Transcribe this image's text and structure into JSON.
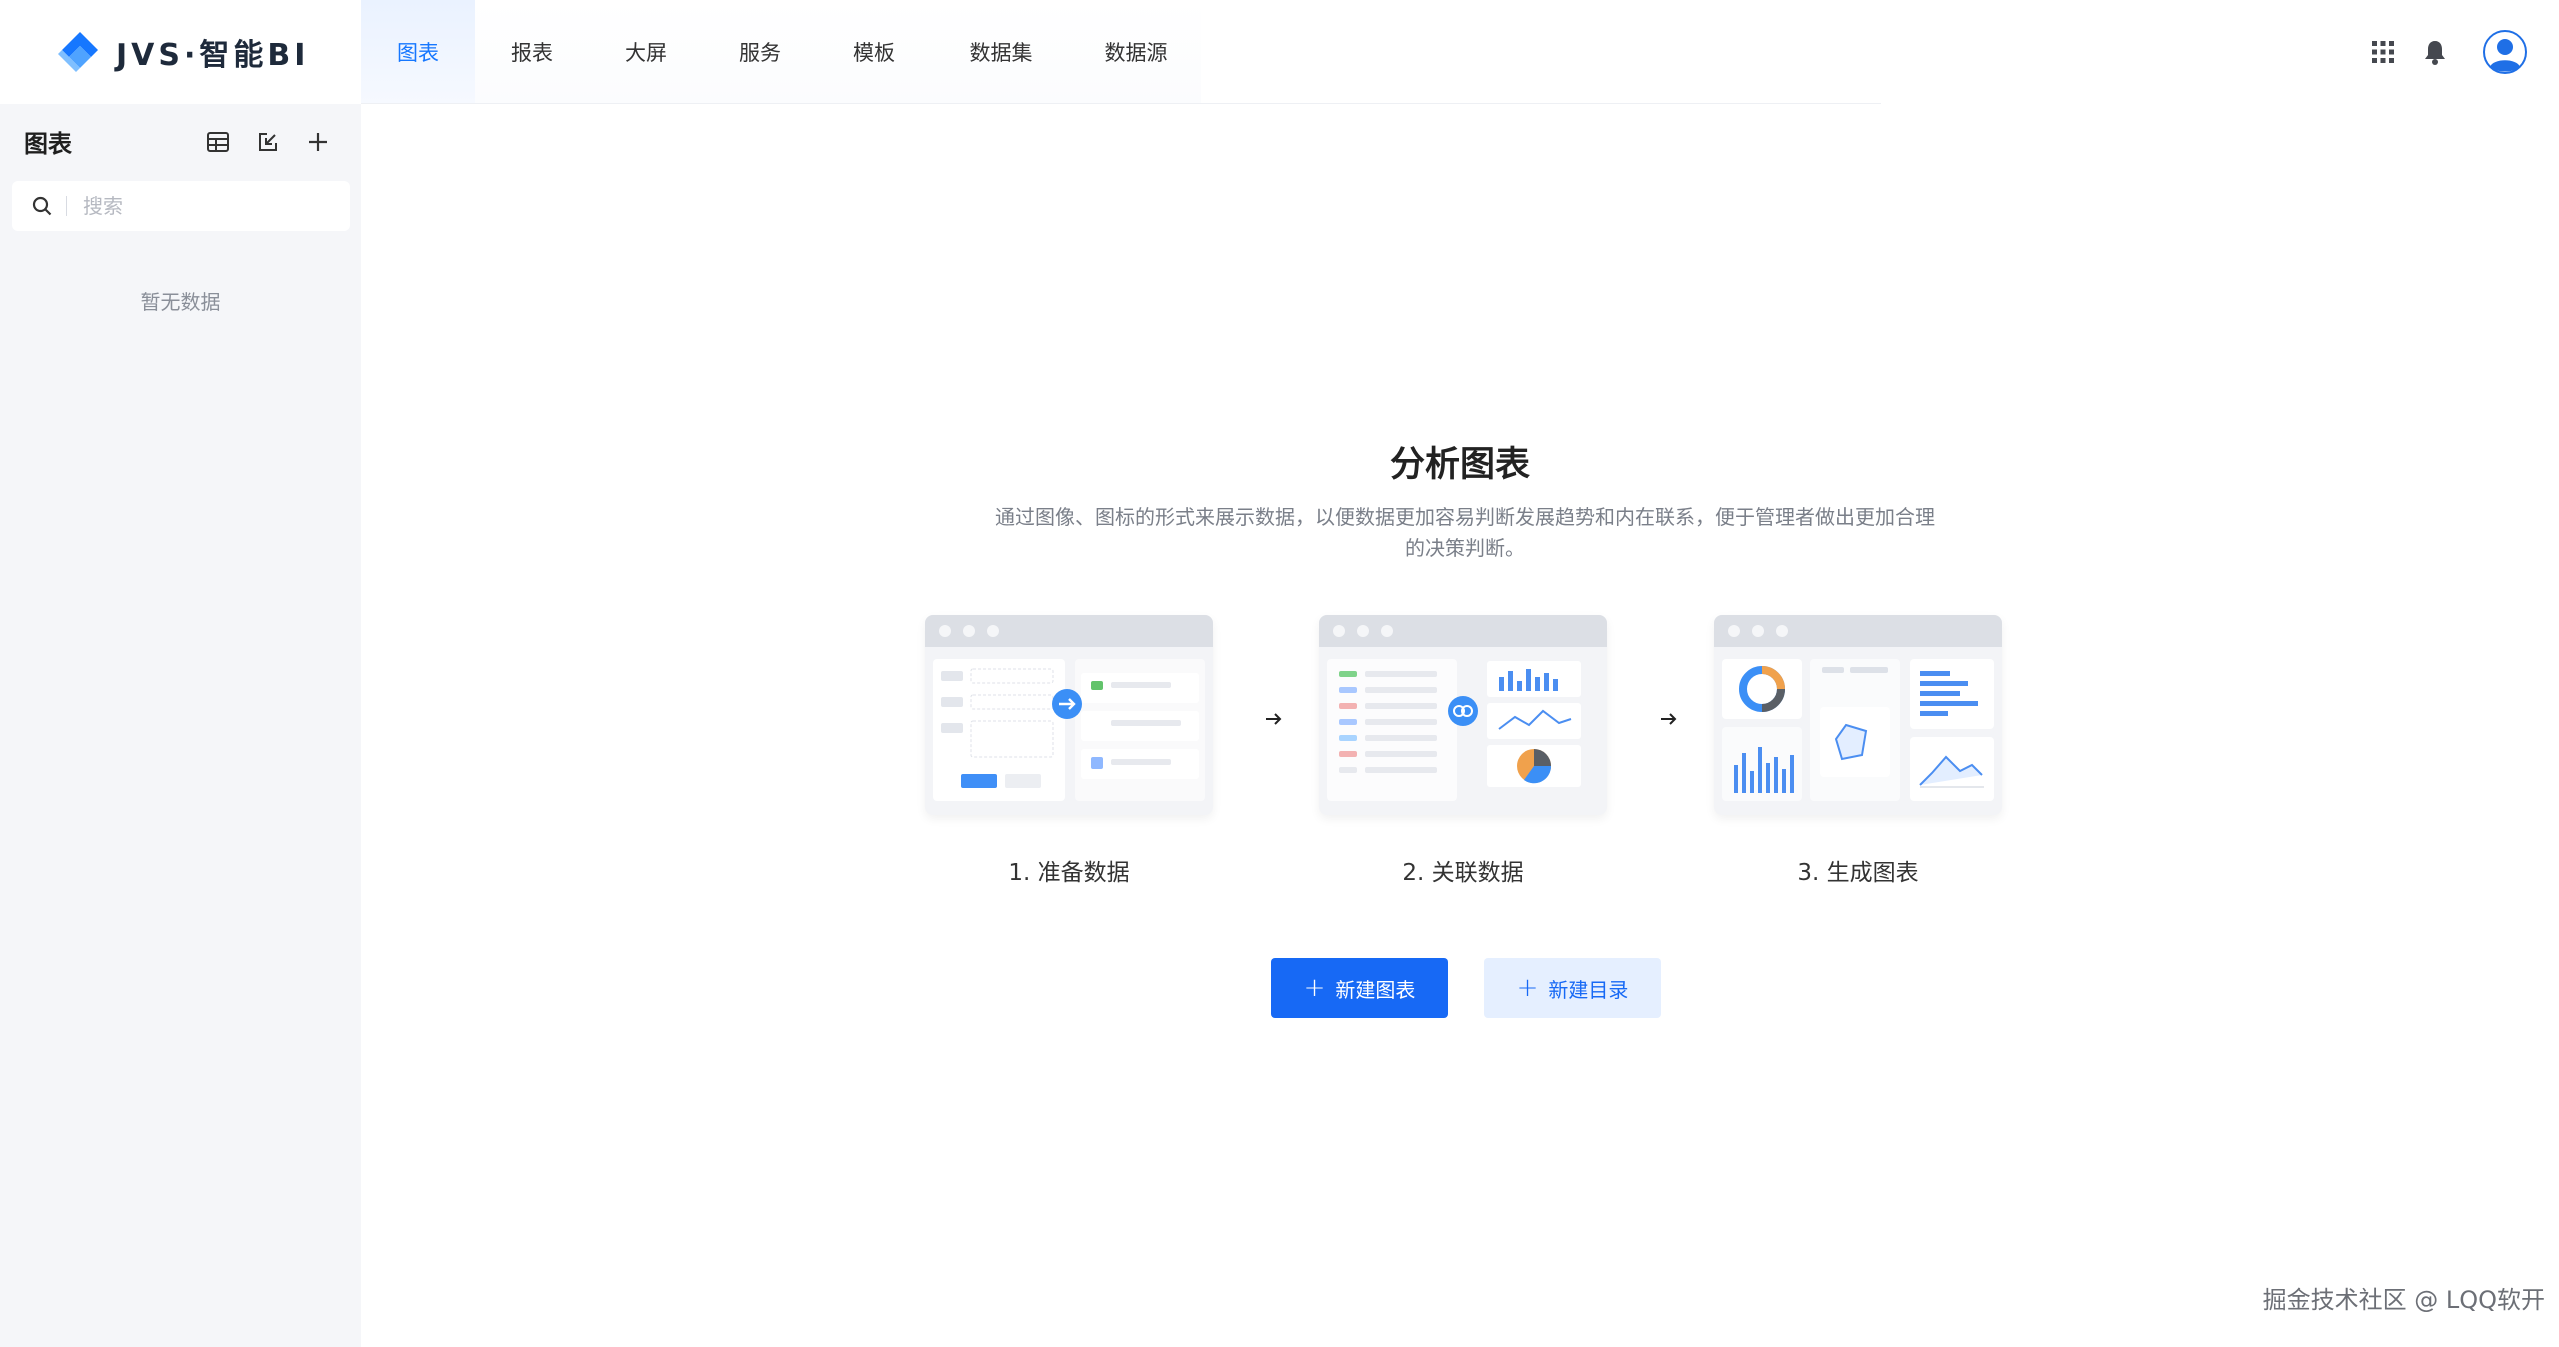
{
  "app": {
    "logo_text": "JVS·智能BI"
  },
  "nav": {
    "items": [
      {
        "label": "图表",
        "active": true
      },
      {
        "label": "报表"
      },
      {
        "label": "大屏"
      },
      {
        "label": "服务"
      },
      {
        "label": "模板"
      },
      {
        "label": "数据集"
      },
      {
        "label": "数据源"
      }
    ]
  },
  "top_icons": [
    "apps-grid-icon",
    "bell-icon",
    "user-avatar-icon"
  ],
  "sidebar": {
    "title": "图表",
    "tools": [
      "table-icon",
      "import-icon",
      "plus-icon"
    ],
    "search_placeholder": "搜索",
    "empty_text": "暂无数据"
  },
  "main": {
    "title": "分析图表",
    "description": "通过图像、图标的形式来展示数据，以便数据更加容易判断发展趋势和内在联系，便于管理者做出更加合理的决策判断。",
    "steps": [
      {
        "label": "1. 准备数据"
      },
      {
        "label": "2. 关联数据"
      },
      {
        "label": "3. 生成图表"
      }
    ],
    "buttons": {
      "new_chart": "新建图表",
      "new_directory": "新建目录"
    }
  },
  "watermark": "掘金技术社区 @ LQQ软开",
  "colors": {
    "accent": "#1769f5",
    "sidebar_bg": "#f5f6f9",
    "nav_active": "#1677ff"
  }
}
